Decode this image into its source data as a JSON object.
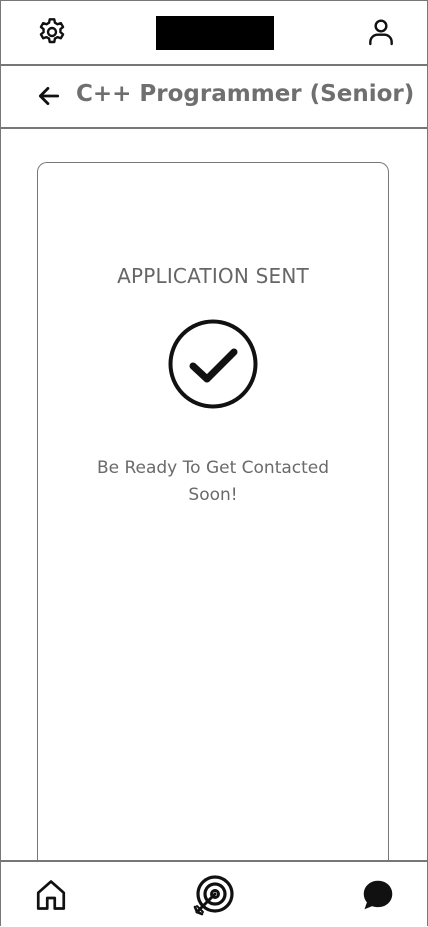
{
  "header": {
    "settings_icon": "gear-icon",
    "profile_icon": "user-icon",
    "logo": "redacted-logo"
  },
  "title_bar": {
    "back_icon": "arrow-left-icon",
    "title": "C++ Programmer (Senior)"
  },
  "card": {
    "status_title": "APPLICATION SENT",
    "status_icon": "check-circle-icon",
    "message": "Be Ready To Get Contacted Soon!"
  },
  "bottom_nav": {
    "items": [
      {
        "icon": "home-icon"
      },
      {
        "icon": "target-icon"
      },
      {
        "icon": "chat-bubble-icon"
      }
    ]
  }
}
